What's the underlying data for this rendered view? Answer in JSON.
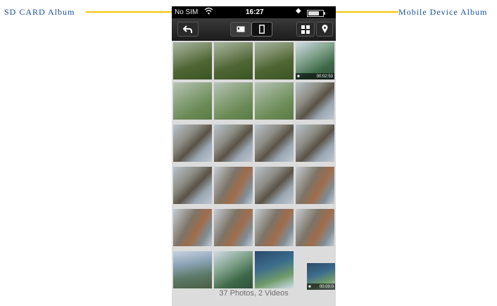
{
  "callouts": {
    "sd_card_album": "SD CARD Album",
    "mobile_device_album": "Mobile Device Album"
  },
  "status_bar": {
    "carrier": "No SIM",
    "time": "16:27",
    "wifi_icon": "wifi-icon",
    "battery_icon": "battery-icon"
  },
  "toolbar": {
    "back_icon": "back-arrow-icon",
    "sd_card_icon": "sd-card-icon",
    "mobile_icon": "phone-icon",
    "grid_icon": "grid-icon",
    "map_pin_icon": "map-pin-icon"
  },
  "photos": {
    "video_duration": "00:02:53",
    "video_duration_2": "00:00:0"
  },
  "footer": {
    "summary": "37 Photos, 2 Videos"
  },
  "colors": {
    "callout_text": "#1a4fa0",
    "callout_line": "#f2c300",
    "toolbar_bg": "#1b1b1b",
    "grid_bg": "#dcdcdc"
  }
}
